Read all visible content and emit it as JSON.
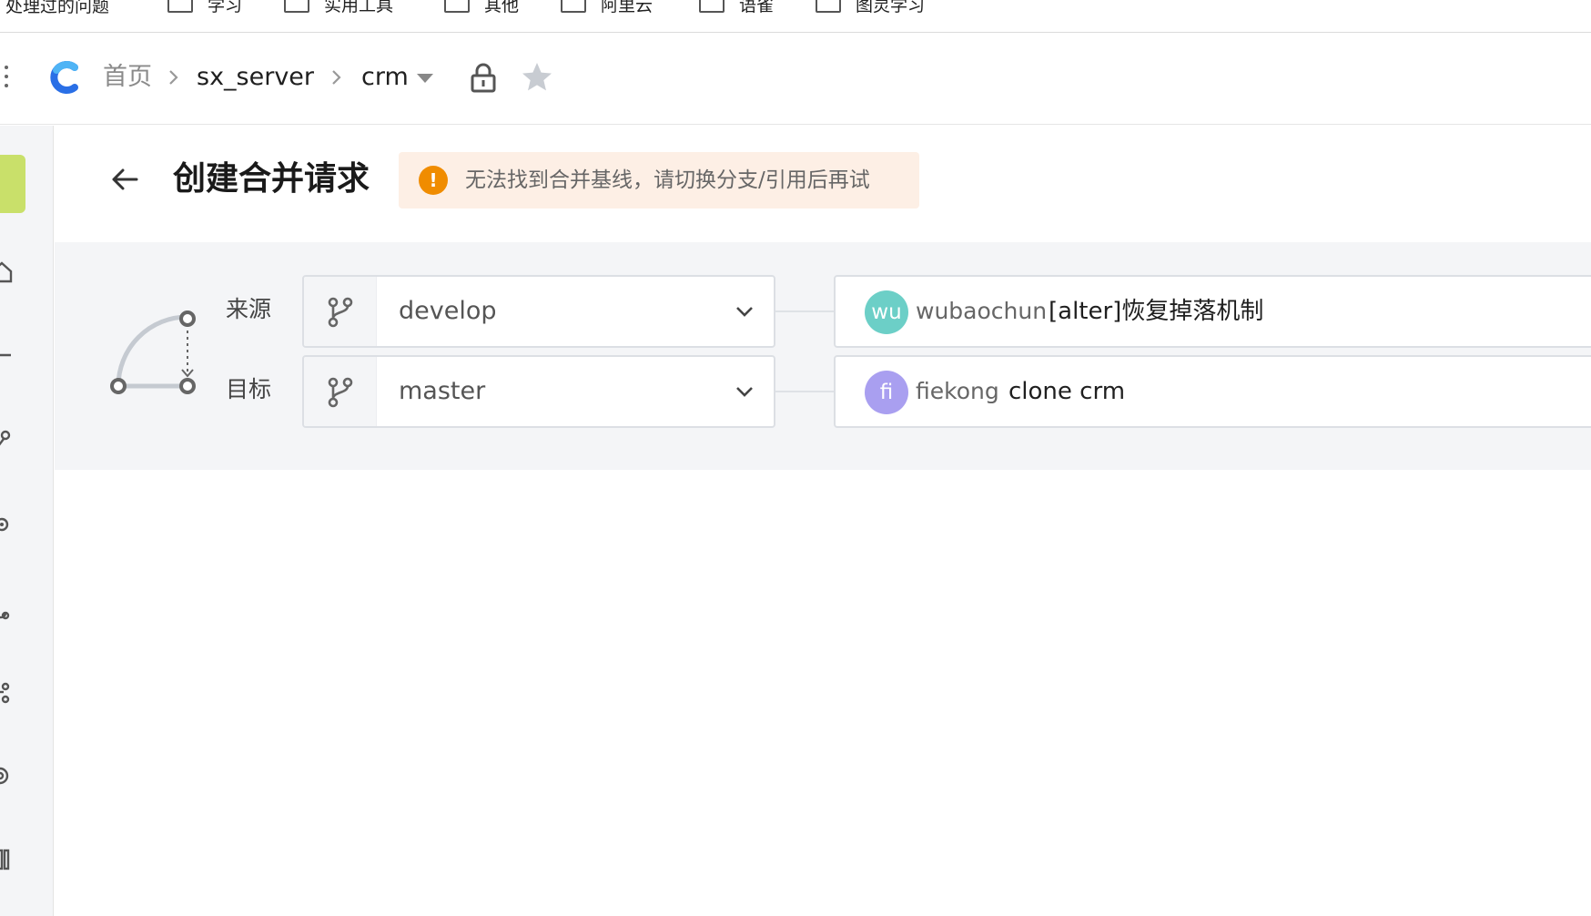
{
  "bookmarks": {
    "first": "处理过的问题",
    "items": [
      "学习",
      "实用工具",
      "其他",
      "阿里云",
      "语雀",
      "图灵学习"
    ]
  },
  "breadcrumb": {
    "home": "首页",
    "repo": "sx_server",
    "project": "crm"
  },
  "page": {
    "title": "创建合并请求",
    "alert": {
      "icon": "!",
      "text": "无法找到合并基线，请切换分支/引用后再试"
    }
  },
  "branches": {
    "source": {
      "label": "来源",
      "branch": "develop",
      "commit": {
        "avatar_text": "wu",
        "author": "wubaochun",
        "message": "[alter]恢复掉落机制",
        "avatar_color": "#6ccfc7"
      }
    },
    "target": {
      "label": "目标",
      "branch": "master",
      "commit": {
        "avatar_text": "fi",
        "author": "fiekong",
        "message": "clone crm",
        "avatar_color": "#a99ff0"
      }
    }
  },
  "colors": {
    "alert_bg": "#fdefe5",
    "alert_icon": "#f08c00",
    "sidebar_logo": "#c9e06a",
    "logo_blue": "#2a6fe6"
  }
}
